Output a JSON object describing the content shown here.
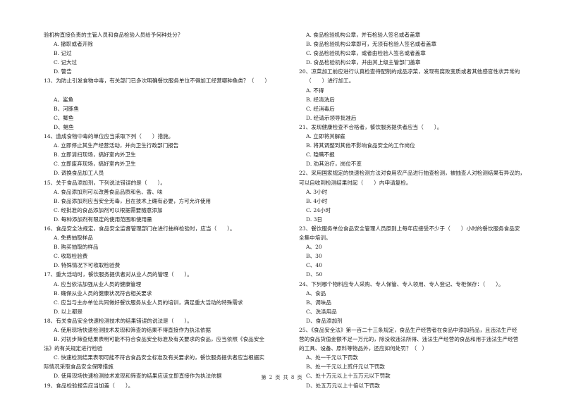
{
  "document": {
    "left_column": [
      {
        "type": "cont",
        "text": "验机构直接负责的主管人员和食品检验人员给予何种处分？"
      },
      {
        "type": "opt",
        "text": "A. 撤职或者开除"
      },
      {
        "type": "opt",
        "text": "B. 记过"
      },
      {
        "type": "opt",
        "text": "C. 记大过"
      },
      {
        "type": "opt",
        "text": "D. 警告"
      },
      {
        "type": "q",
        "text": "13、为防止引发食物中毒，有关部门已多次明确餐饮服务单位不得加工经营哪种鱼类？（　　）"
      },
      {
        "type": "blank",
        "text": ""
      },
      {
        "type": "opt",
        "text": "A、鲨鱼"
      },
      {
        "type": "opt",
        "text": "B、河豚鱼"
      },
      {
        "type": "opt",
        "text": "C、鲫鱼"
      },
      {
        "type": "opt",
        "text": "D、鲳鱼"
      },
      {
        "type": "q",
        "text": "14、造成食物中毒的单位应当采取下列（　　）措施。"
      },
      {
        "type": "opt",
        "text": "A. 立即停止其生产经营活动，并向卫生行政部门报告"
      },
      {
        "type": "opt",
        "text": "B. 立即清扫现场，搞好室内外卫生"
      },
      {
        "type": "opt",
        "text": "C. 立即废弃现场，搞好室内外卫生"
      },
      {
        "type": "opt",
        "text": "D. 调换食品加工人员"
      },
      {
        "type": "q",
        "text": "15、关于食品添加剂，下列说法错误的是（　　）。"
      },
      {
        "type": "opt",
        "text": "A. 食品添加剂可以改善食品品质和色、香、味"
      },
      {
        "type": "opt",
        "text": "B. 食品添加剂应当安全无毒，且在技术上确有必要，方可允许使用"
      },
      {
        "type": "opt",
        "text": "C. 经批准的食品添加剂可以根据需要随意添加"
      },
      {
        "type": "opt",
        "text": "D. 每种添加剂有限定的使用范围和使用量"
      },
      {
        "type": "q",
        "text": "16、食品安全法规定，食品安全监督管理部门在进行抽样检验时，应当（　　）。"
      },
      {
        "type": "opt",
        "text": "A. 免费抽取样品"
      },
      {
        "type": "opt",
        "text": "B. 购买抽取的样品"
      },
      {
        "type": "opt",
        "text": "C. 收取检验费"
      },
      {
        "type": "opt",
        "text": "D. 特殊情况下可收取检验费"
      },
      {
        "type": "q",
        "text": "17、重大活动时，餐饮服务提供者对从业人员的管理（　　）。"
      },
      {
        "type": "opt",
        "text": "A. 应当依法加强从业人员的健康管理"
      },
      {
        "type": "opt",
        "text": "B. 确保从业人员的健康状况符合相关要求"
      },
      {
        "type": "opt",
        "text": "C. 应当与主办单位共同做好餐饮服务从业人员的培训，满足重大活动的特殊需求"
      },
      {
        "type": "opt",
        "text": "D. 以上都是"
      },
      {
        "type": "q",
        "text": "18、有关食品安全快速检测技术的结果错误的说法是（　　）。"
      },
      {
        "type": "opt",
        "text": "A. 使用现场快速检测技术发现和筛查的结果不得直接作为执法依据"
      },
      {
        "type": "opt",
        "text": "B. 对初步筛查结果表明可能不符合食品安全标准及有关要求的食品，应当依照《食品安全"
      },
      {
        "type": "cont",
        "text": "法》的有关规定进行检验"
      },
      {
        "type": "opt",
        "text": "C. 快速检测结果表明可能不符合食品安全标准及有关要求的，餐饮服务提供者应当根据实"
      },
      {
        "type": "cont",
        "text": "际情况采取食品安全保障措施"
      },
      {
        "type": "opt",
        "text": "D. 使用现场快速检测技术发现和筛查的结果应该立即直接作为执法依据"
      },
      {
        "type": "q",
        "text": "19、食品检验报告应当加盖（　　）。"
      }
    ],
    "right_column": [
      {
        "type": "opt",
        "text": "A. 食品检验机构公章，并有检验人签名或者盖章"
      },
      {
        "type": "opt",
        "text": "B. 食品检验机构公章即可，无须有检验人签名或者盖章"
      },
      {
        "type": "opt",
        "text": "C. 食品检验机构公章，或者由检验人签名或者盖章"
      },
      {
        "type": "opt",
        "text": "D. 食品检验机构公章，并由其上级主管部门盖章"
      },
      {
        "type": "qind",
        "text": "20、凉菜加工前应进行认真检查待配制的成品凉菜，发现有腐败变质或者其他感官性状异常的"
      },
      {
        "type": "opt",
        "text": "（　　）进行加工。"
      },
      {
        "type": "opt",
        "text": "A. 不得"
      },
      {
        "type": "opt",
        "text": "B. 经清洗后"
      },
      {
        "type": "opt",
        "text": "C. 经消毒后"
      },
      {
        "type": "opt",
        "text": "D. 经请示领导批准后"
      },
      {
        "type": "qind",
        "text": "21、发现健康检查不合格者，餐饮服务提供者应当（　　）。"
      },
      {
        "type": "opt",
        "text": "A. 立即将其解雇"
      },
      {
        "type": "opt",
        "text": "B. 将其调整到其他不影响食品安全的工作岗位"
      },
      {
        "type": "opt",
        "text": "C. 隐瞒不报"
      },
      {
        "type": "opt",
        "text": "D. 劝其治疗，岗位不变"
      },
      {
        "type": "qind",
        "text": "22、采用国家规定的快速检测方法对食用农产品进行抽查检测，被抽查人对检测结果有异议的，"
      },
      {
        "type": "qind",
        "text": "可以自收到检测结果时起（　　）内申请复检。"
      },
      {
        "type": "opt",
        "text": "A. 3小时"
      },
      {
        "type": "opt",
        "text": "B. 4小时"
      },
      {
        "type": "opt",
        "text": "C. 24小时"
      },
      {
        "type": "opt",
        "text": "D. 3日"
      },
      {
        "type": "qind",
        "text": "23、餐饮服务单位食品安全管理人员原则上每年应接受不少于（　　）小时的餐饮服务食品安"
      },
      {
        "type": "qind",
        "text": "全集中培训。"
      },
      {
        "type": "opt",
        "text": "A、20"
      },
      {
        "type": "opt",
        "text": "B、30"
      },
      {
        "type": "opt",
        "text": "C、40"
      },
      {
        "type": "opt",
        "text": "D、50"
      },
      {
        "type": "qind",
        "text": "24、下列哪个物料应专人采购、专人保管、专人领用、专人登记、专柜保存：（　　）。"
      },
      {
        "type": "opt",
        "text": "A、食品"
      },
      {
        "type": "opt",
        "text": "B、调味品"
      },
      {
        "type": "opt",
        "text": "C、洗涤用品"
      },
      {
        "type": "opt",
        "text": "D、食品添加剂"
      },
      {
        "type": "qind",
        "text": "25、《食品安全法》第一百二十三条规定，食品生产经营者在食品中添加药品，且违法生产经"
      },
      {
        "type": "qind",
        "text": "营的食品货值金额不足一万元的，除没收违法所得、违法生产经营的食品和用于违法生产经营"
      },
      {
        "type": "qind",
        "text": "的工具、设备、原料等物品外，还应如何处罚？（　）"
      },
      {
        "type": "opt",
        "text": "A、处一千元以下罚款"
      },
      {
        "type": "opt",
        "text": "B、处一千元以上贰仟元以下罚款"
      },
      {
        "type": "opt",
        "text": "C、处十万元以上十五万元以下罚款"
      },
      {
        "type": "opt",
        "text": "D、处五万元以上十倍以下罚款"
      }
    ],
    "footer": "第 2 页 共 8 页"
  }
}
